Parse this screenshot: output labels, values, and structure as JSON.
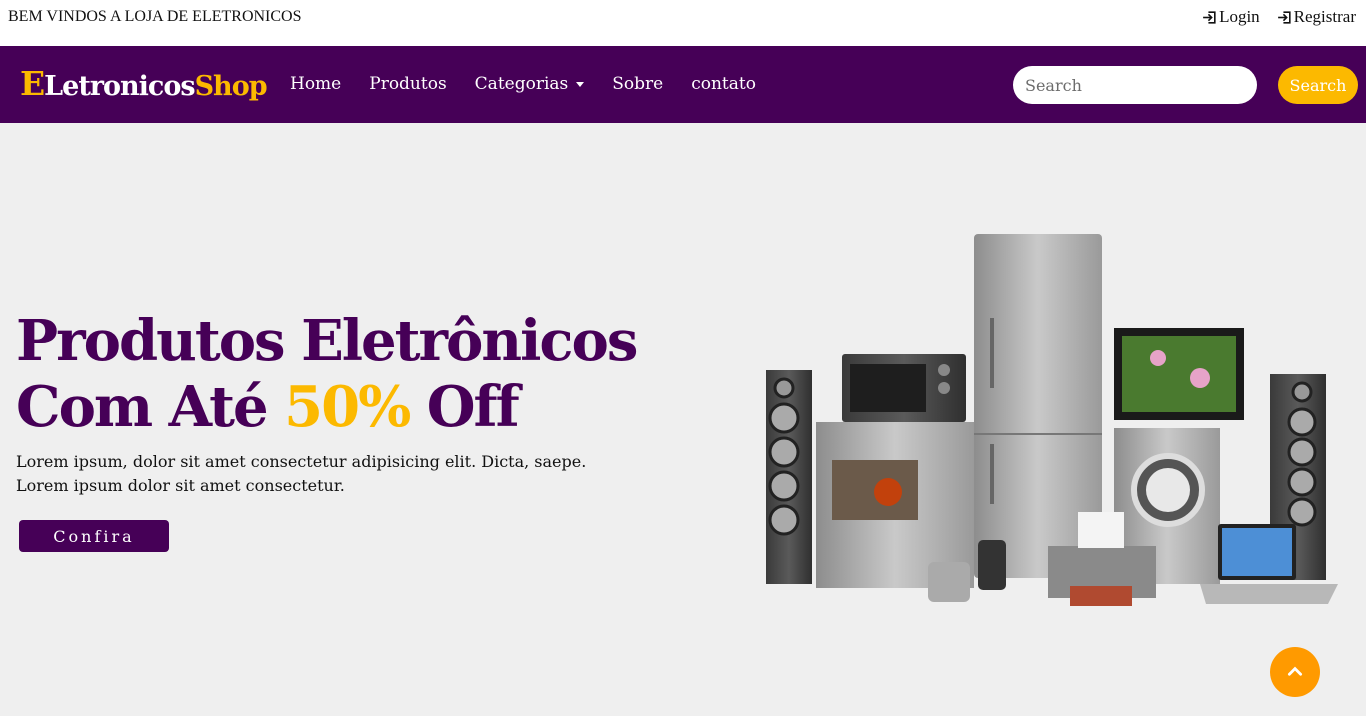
{
  "topbar": {
    "welcome": "BEM VINDOS A LOJA DE ELETRONICOS",
    "login": "Login",
    "register": "Registrar"
  },
  "brand": {
    "part1": "E",
    "part2": "Letronicos",
    "part3": "Shop"
  },
  "nav": {
    "items": [
      "Home",
      "Produtos",
      "Categorias",
      "Sobre",
      "contato"
    ],
    "search_placeholder": "Search",
    "search_button": "Search"
  },
  "hero": {
    "line1": "Produtos Eletrônicos",
    "line2_pre": "Com Até ",
    "line2_highlight": "50%",
    "line2_post": " Off",
    "text_line1": "Lorem ipsum, dolor sit amet consectetur adipisicing elit. Dicta, saepe.",
    "text_line2": "Lorem ipsum dolor sit amet consectetur.",
    "cta": "Confira"
  },
  "icons": {
    "login": "login-icon",
    "register": "register-icon",
    "dropdown": "caret-down-icon",
    "scroll_top": "chevron-up-icon"
  },
  "colors": {
    "primary": "#460057",
    "accent": "#fcb900",
    "scroll_button": "#ff9a00",
    "hero_bg": "#efefef"
  }
}
